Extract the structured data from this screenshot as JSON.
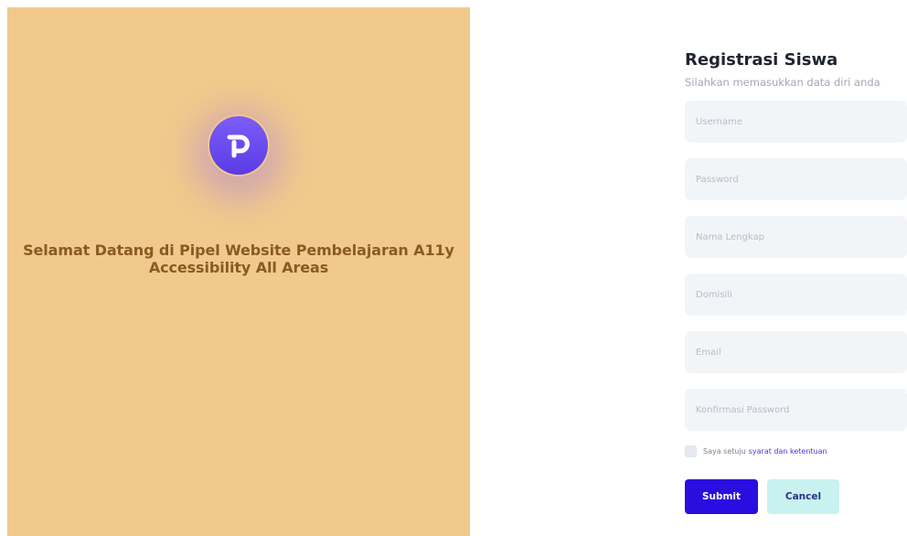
{
  "hero": {
    "title_line1": "Selamat Datang di Pipel Website Pembelajaran A11y",
    "title_line2": "Accessibility All Areas",
    "logo_icon": "pipel-logo-icon",
    "background_color": "#f1c98c",
    "logo_color": "#6a4bf0"
  },
  "form": {
    "title": "Registrasi Siswa",
    "subtitle": "Silahkan memasukkan data diri anda",
    "fields": [
      {
        "name": "username",
        "placeholder": "Username",
        "value": ""
      },
      {
        "name": "password",
        "placeholder": "Password",
        "value": ""
      },
      {
        "name": "fullname",
        "placeholder": "Nama Lengkap",
        "value": ""
      },
      {
        "name": "domicile",
        "placeholder": "Domisili",
        "value": ""
      },
      {
        "name": "email",
        "placeholder": "Email",
        "value": ""
      },
      {
        "name": "confirm_password",
        "placeholder": "Konfirmasi Password",
        "value": ""
      }
    ],
    "agree_text": "Saya setuju",
    "agree_link": "syarat dan ketentuan",
    "submit_label": "Submit",
    "cancel_label": "Cancel",
    "accent_color": "#2a0ee0",
    "cancel_color": "#c8f2ef"
  }
}
